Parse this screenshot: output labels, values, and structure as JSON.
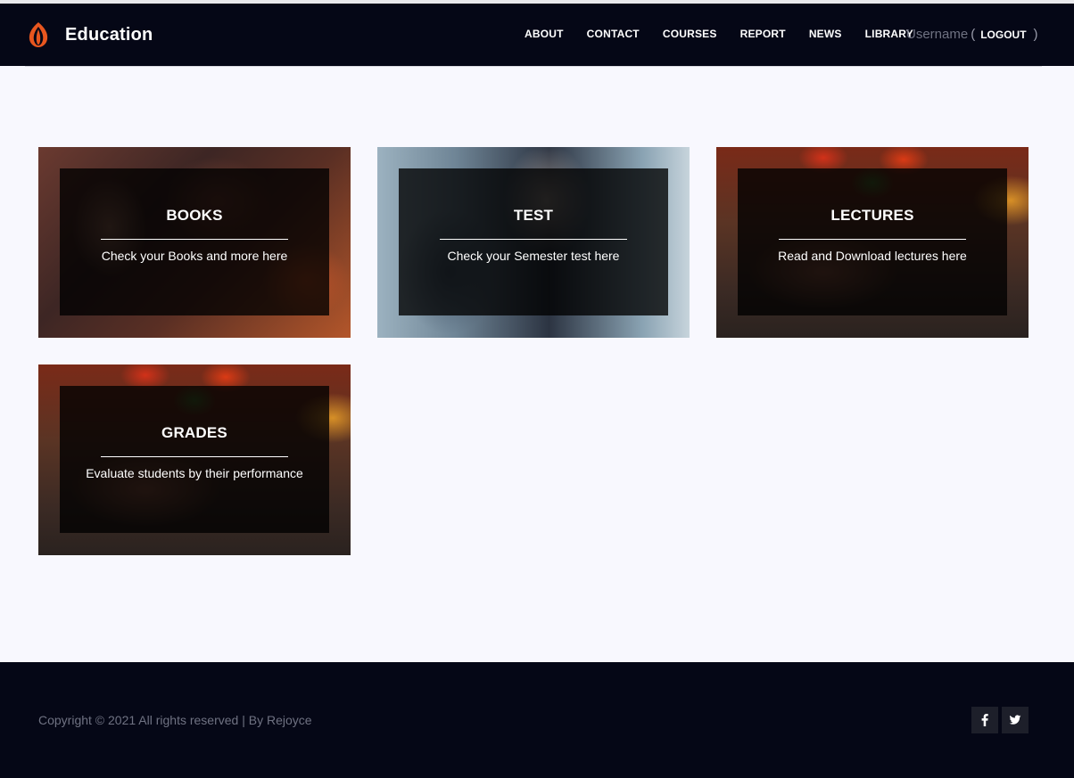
{
  "header": {
    "brand": "Education",
    "nav": [
      "ABOUT",
      "CONTACT",
      "COURSES",
      "REPORT",
      "NEWS",
      "LIBRARY"
    ],
    "username": "Username",
    "paren_open": "(",
    "logout": "LOGOUT",
    "paren_close": ")"
  },
  "cards": [
    {
      "title": "BOOKS",
      "description": "Check your Books and more here"
    },
    {
      "title": "TEST",
      "description": "Check your Semester test here"
    },
    {
      "title": "LECTURES",
      "description": "Read and Download lectures here"
    },
    {
      "title": "GRADES",
      "description": "Evaluate students by their performance"
    }
  ],
  "footer": {
    "copyright": "Copyright © 2021 All rights reserved | By Rejoyce",
    "social": [
      {
        "icon": "facebook-icon",
        "glyph": "f"
      },
      {
        "icon": "twitter-icon",
        "glyph": "t"
      }
    ]
  },
  "colors": {
    "header_bg": "#050716",
    "page_bg": "#f8f8fe",
    "logo_accent": "#e8561f"
  }
}
